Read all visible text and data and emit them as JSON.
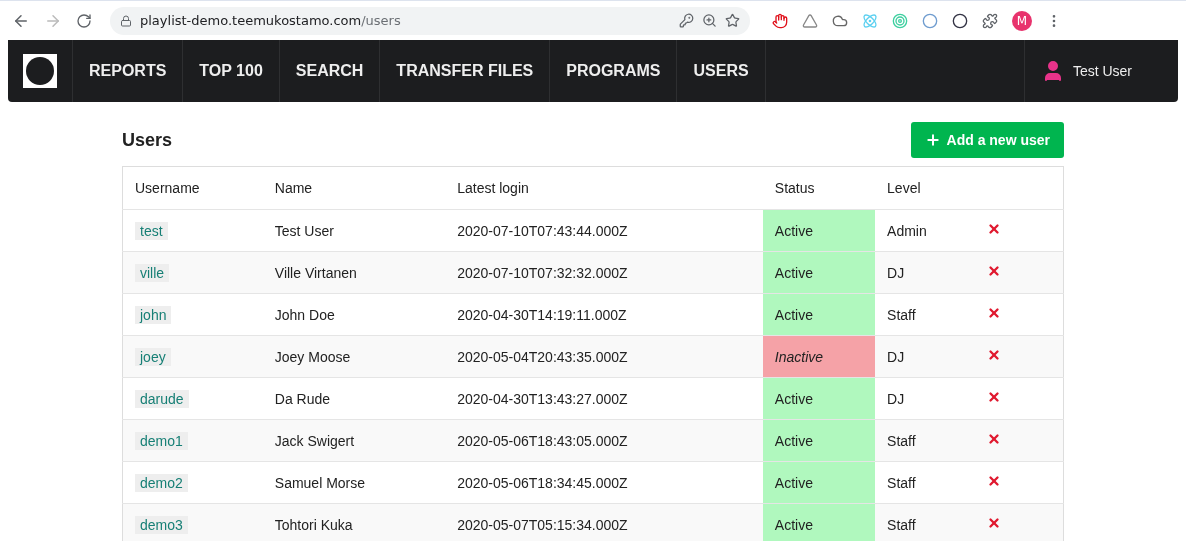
{
  "browser": {
    "url_host": "playlist-demo.teemukostamo.com",
    "url_path": "/users",
    "profile_initial": "M"
  },
  "nav": {
    "items": [
      {
        "label": "REPORTS",
        "selected": false
      },
      {
        "label": "TOP 100",
        "selected": false
      },
      {
        "label": "SEARCH",
        "selected": false
      },
      {
        "label": "TRANSFER FILES",
        "selected": false
      },
      {
        "label": "PROGRAMS",
        "selected": false
      },
      {
        "label": "USERS",
        "selected": false
      }
    ],
    "user": "Test User"
  },
  "page": {
    "title": "Users",
    "add_button": "Add a new user"
  },
  "table": {
    "columns": [
      "Username",
      "Name",
      "Latest login",
      "Status",
      "Level"
    ],
    "rows": [
      {
        "username": "test",
        "name": "Test User",
        "login": "2020-07-10T07:43:44.000Z",
        "status": "Active",
        "active": true,
        "level": "Admin"
      },
      {
        "username": "ville",
        "name": "Ville Virtanen",
        "login": "2020-07-10T07:32:32.000Z",
        "status": "Active",
        "active": true,
        "level": "DJ"
      },
      {
        "username": "john",
        "name": "John Doe",
        "login": "2020-04-30T14:19:11.000Z",
        "status": "Active",
        "active": true,
        "level": "Staff"
      },
      {
        "username": "joey",
        "name": "Joey Moose",
        "login": "2020-05-04T20:43:35.000Z",
        "status": "Inactive",
        "active": false,
        "level": "DJ"
      },
      {
        "username": "darude",
        "name": "Da Rude",
        "login": "2020-04-30T13:43:27.000Z",
        "status": "Active",
        "active": true,
        "level": "DJ"
      },
      {
        "username": "demo1",
        "name": "Jack Swigert",
        "login": "2020-05-06T18:43:05.000Z",
        "status": "Active",
        "active": true,
        "level": "Staff"
      },
      {
        "username": "demo2",
        "name": "Samuel Morse",
        "login": "2020-05-06T18:34:45.000Z",
        "status": "Active",
        "active": true,
        "level": "Staff"
      },
      {
        "username": "demo3",
        "name": "Tohtori Kuka",
        "login": "2020-05-07T05:15:34.000Z",
        "status": "Active",
        "active": true,
        "level": "Staff"
      }
    ]
  }
}
